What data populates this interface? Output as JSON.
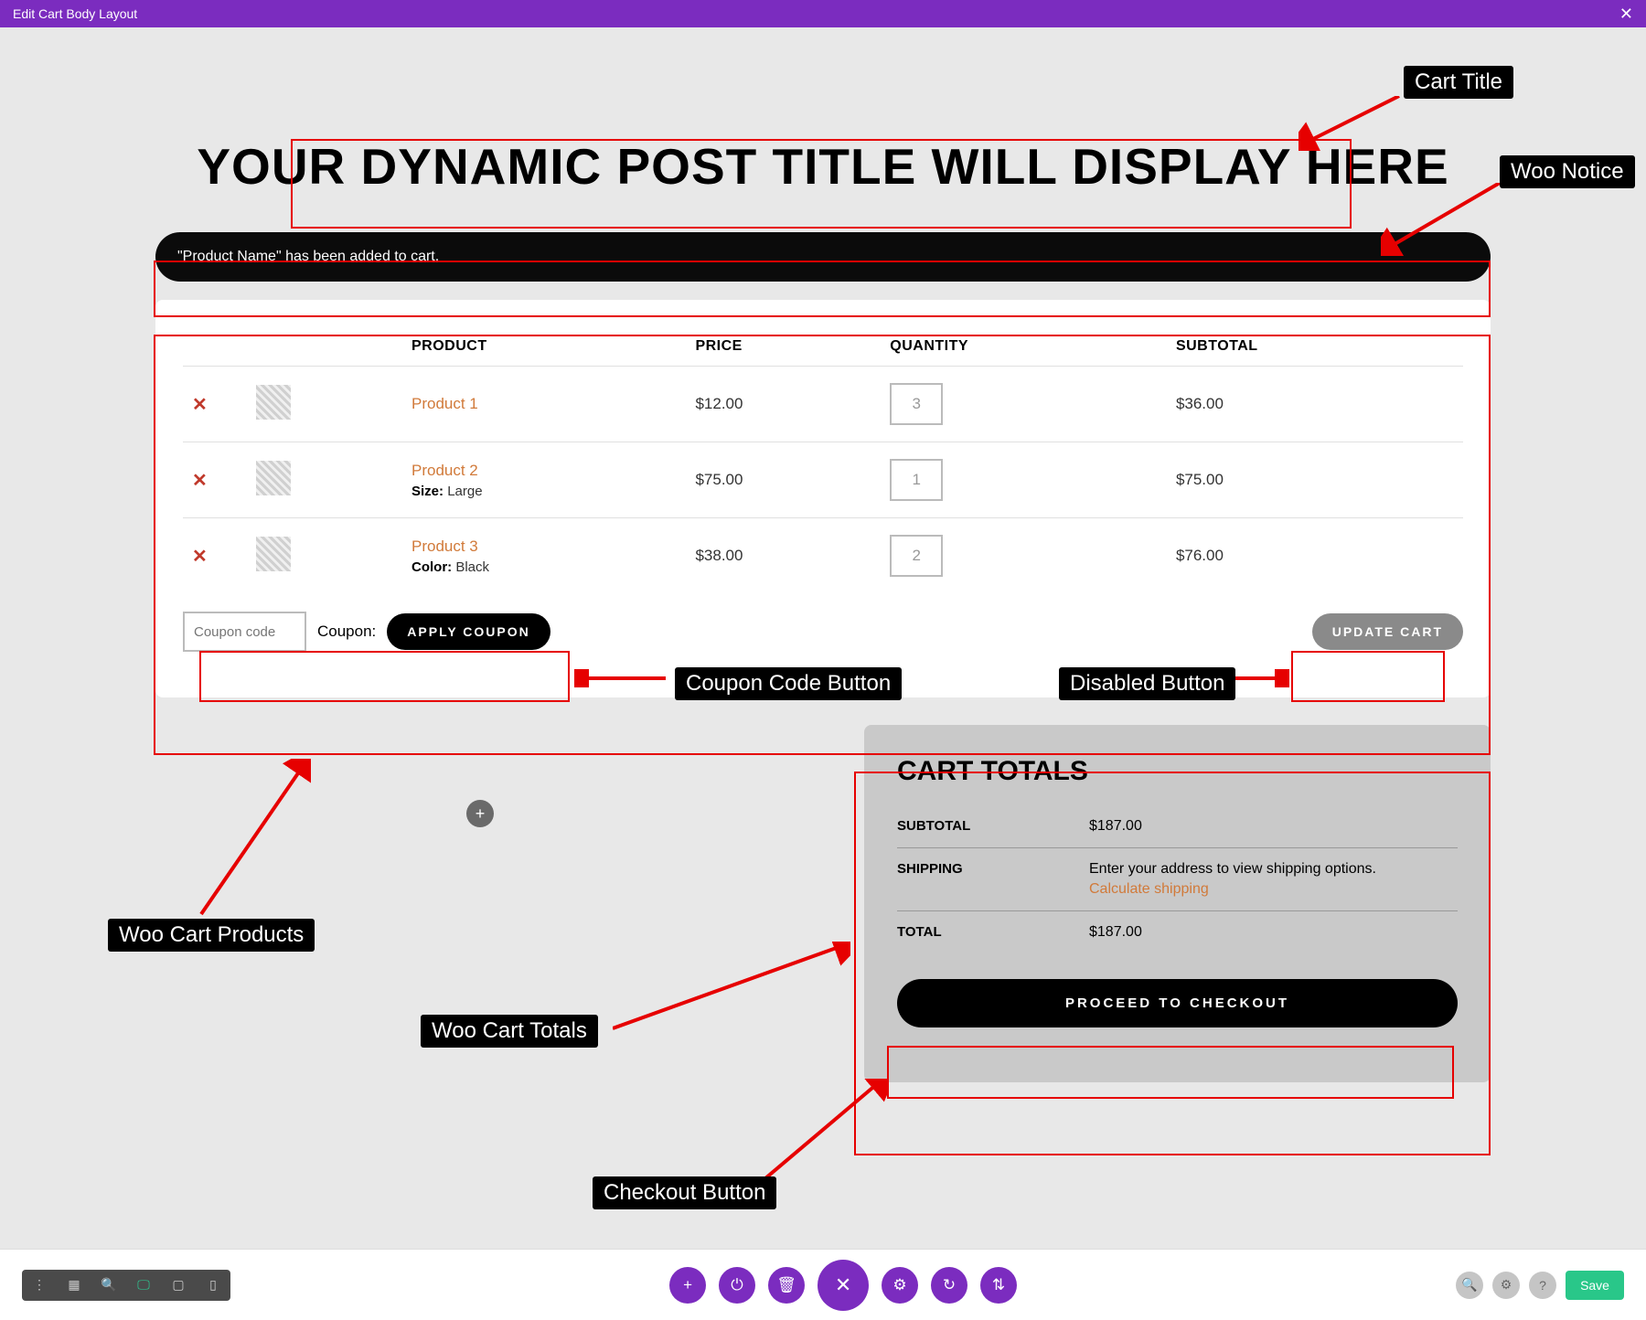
{
  "topbar": {
    "title": "Edit Cart Body Layout"
  },
  "annotations": {
    "cart_title": "Cart Title",
    "woo_notice": "Woo Notice",
    "coupon_button": "Coupon Code Button",
    "disabled_button": "Disabled Button",
    "woo_cart_products": "Woo Cart Products",
    "woo_cart_totals": "Woo Cart Totals",
    "checkout_button": "Checkout Button"
  },
  "title": "YOUR DYNAMIC POST TITLE WILL DISPLAY HERE",
  "notice": "\"Product Name\" has been added to cart.",
  "cart": {
    "headers": {
      "product": "PRODUCT",
      "price": "PRICE",
      "quantity": "QUANTITY",
      "subtotal": "SUBTOTAL"
    },
    "items": [
      {
        "name": "Product 1",
        "meta_label": "",
        "meta_value": "",
        "price": "$12.00",
        "qty": "3",
        "subtotal": "$36.00"
      },
      {
        "name": "Product 2",
        "meta_label": "Size:",
        "meta_value": "Large",
        "price": "$75.00",
        "qty": "1",
        "subtotal": "$75.00"
      },
      {
        "name": "Product 3",
        "meta_label": "Color:",
        "meta_value": "Black",
        "price": "$38.00",
        "qty": "2",
        "subtotal": "$76.00"
      }
    ],
    "coupon_placeholder": "Coupon code",
    "coupon_label": "Coupon:",
    "apply_coupon": "APPLY COUPON",
    "update_cart": "UPDATE CART"
  },
  "totals": {
    "title": "CART TOTALS",
    "subtotal_label": "SUBTOTAL",
    "subtotal": "$187.00",
    "shipping_label": "SHIPPING",
    "shipping_text": "Enter your address to view shipping options.",
    "calc_shipping": "Calculate shipping",
    "total_label": "TOTAL",
    "total": "$187.00",
    "checkout": "PROCEED TO CHECKOUT"
  },
  "bottombar": {
    "save": "Save"
  }
}
